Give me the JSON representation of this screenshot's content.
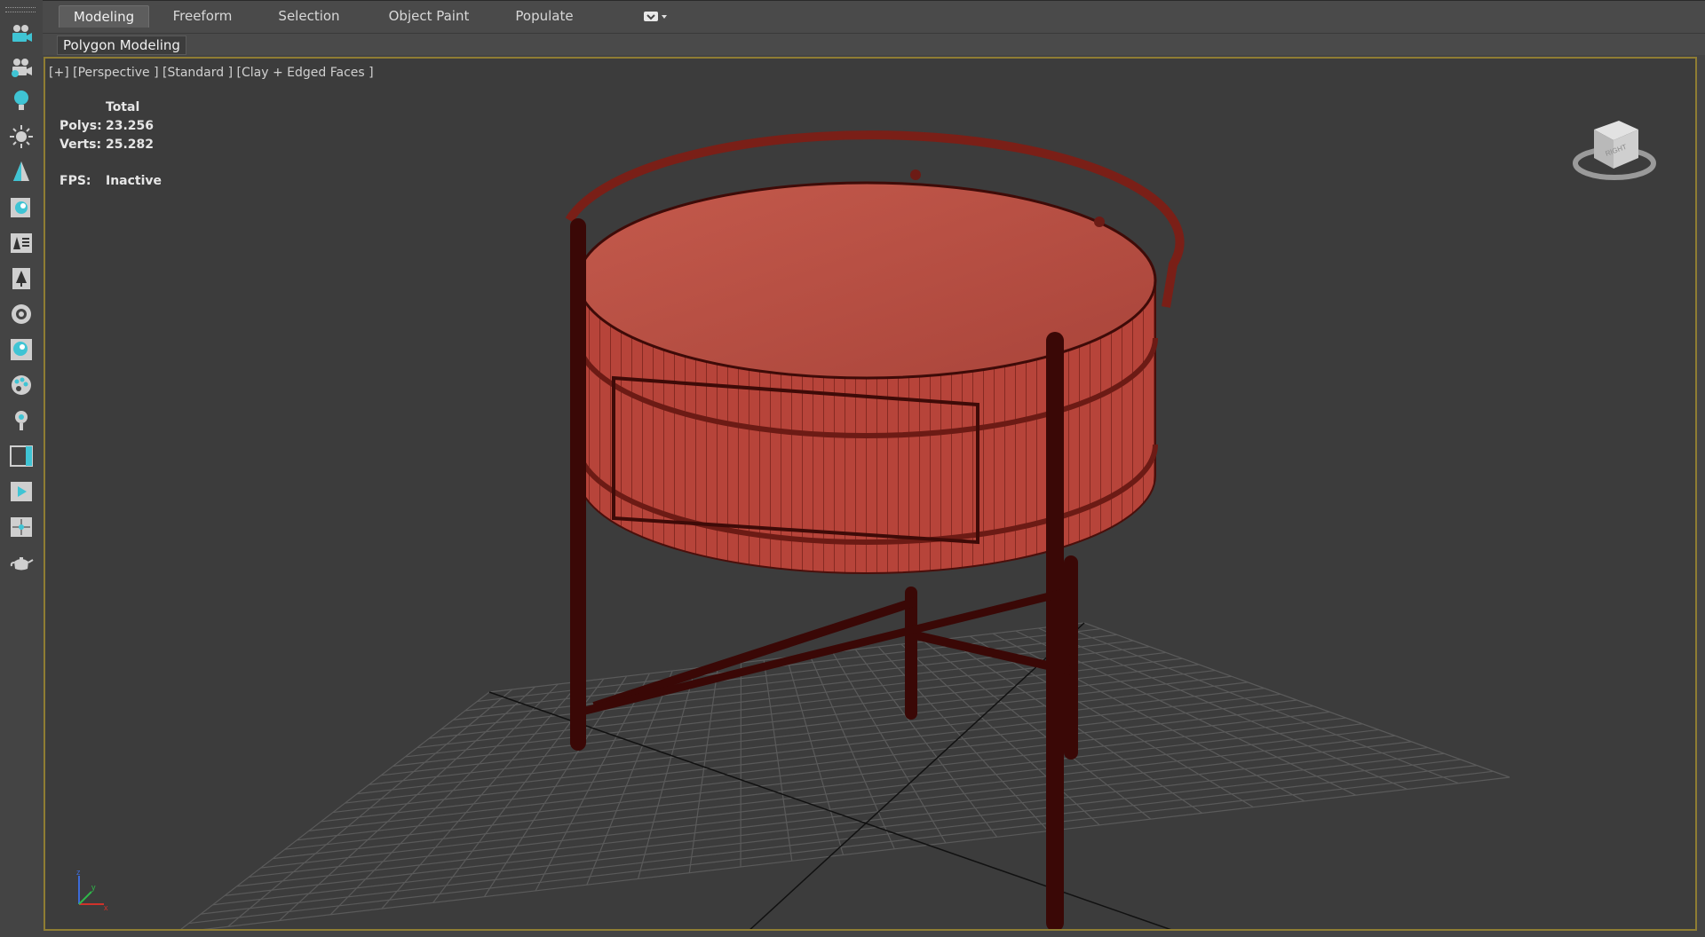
{
  "ribbon": {
    "tabs": [
      {
        "label": "Modeling",
        "active": true
      },
      {
        "label": "Freeform",
        "active": false
      },
      {
        "label": "Selection",
        "active": false
      },
      {
        "label": "Object Paint",
        "active": false
      },
      {
        "label": "Populate",
        "active": false
      }
    ],
    "panel_label": "Polygon Modeling"
  },
  "toolbar": {
    "icons": [
      "camera-icon",
      "camera-add-icon",
      "light-bulb-icon",
      "sun-icon",
      "tree-icon",
      "material-editor-icon",
      "text-panel-icon",
      "foliage-icon",
      "render-setup-icon",
      "sphere-map-icon",
      "paint-palette-icon",
      "light-probe-icon",
      "viewport-layout-icon",
      "render-frame-icon",
      "scene-explorer-icon",
      "teapot-icon"
    ]
  },
  "viewport": {
    "label": "[+] [Perspective ] [Standard ] [Clay + Edged Faces ]",
    "stats": {
      "header": "Total",
      "polys_label": "Polys:",
      "polys_value": "23.256",
      "verts_label": "Verts:",
      "verts_value": "25.282",
      "fps_label": "FPS:",
      "fps_value": "Inactive"
    },
    "viewcube_face": "RIGHT",
    "colors": {
      "border_active": "#8f7d33",
      "model": "#b24a3e",
      "grid": "#5b5b5b"
    }
  }
}
